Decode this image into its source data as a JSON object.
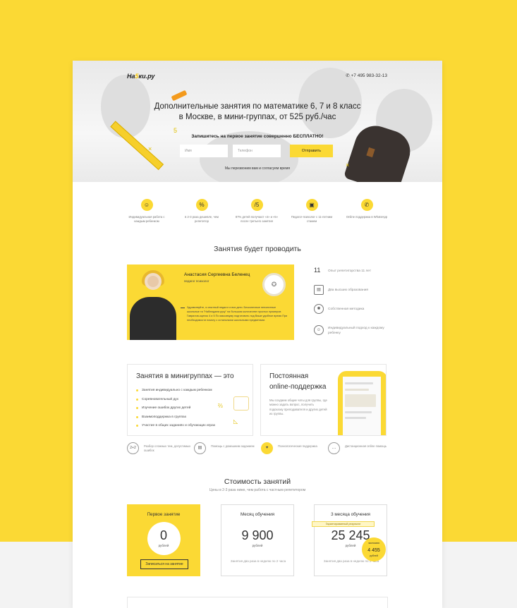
{
  "header": {
    "logo_prefix": "На",
    "logo_mark": "5",
    "logo_suffix": "ки.ру",
    "phone": "+7 495 983-32-13"
  },
  "hero": {
    "title_line1": "Дополнительные занятия по математике 6, 7 и 8 класс",
    "title_line2": "в Москве, в мини-группах, от 525 руб./час",
    "subtitle": "Запишитесь на первое занятие совершенно БЕСПЛАТНО!",
    "name_placeholder": "Имя",
    "phone_placeholder": "Телефон",
    "submit_label": "Отправить",
    "note": "Мы перезвоним вам и согласуем время"
  },
  "features": [
    {
      "icon": "smile-icon",
      "glyph": "☺",
      "text": "Индивидуальная работа с каждым ребенком"
    },
    {
      "icon": "percent-icon",
      "glyph": "%",
      "text": "в 2-3 раза дешевле, чем репетитор"
    },
    {
      "icon": "grade-icon",
      "glyph": "/5",
      "text": "87% детей получают «4» и «5» после третьего занятия"
    },
    {
      "icon": "briefcase-icon",
      "glyph": "▣",
      "text": "Педагог-психолог с 11-летним стажем"
    },
    {
      "icon": "whatsapp-icon",
      "glyph": "✆",
      "text": "Online поддержка в WhatsApp"
    }
  ],
  "teacher_section": {
    "heading": "Занятия будет проводить",
    "name": "Анастасия Сергеевна Беленец",
    "role": "педагог психолог",
    "quote": "Здравствуйте, я опытный педагог и вся дети. Бесконечные непонятные школьные та \"Наблюдаем руку\" на большом количестве простых примеров Гаврилов-оценок 4 и 5 По максимуму подготовить под Ваше удобное время При необходимости помогу с остальными школьными предметами."
  },
  "stats": [
    {
      "icon": "number-11",
      "value": "11",
      "text": "Опыт репетиторства 11 лет"
    },
    {
      "icon": "diploma-icon",
      "value": "",
      "text": "Два высших образования"
    },
    {
      "icon": "brain-icon",
      "value": "",
      "text": "Собственная методика"
    },
    {
      "icon": "smile-icon",
      "value": "",
      "text": "Индивидуальный подход к каждому ребенку"
    }
  ],
  "card_groups": {
    "title": "Занятия в минигруппах — это",
    "items": [
      "Занятия индивидуально с каждым ребенком",
      "Соревновательный дух",
      "Изучение ошибок других детей",
      "Взаимоподдержка в группах",
      "Участие в общих заданиях и обучающих играх"
    ]
  },
  "card_support": {
    "title_line1": "Постоянная",
    "title_line2": "online-поддержка",
    "text": "Мы создаем общие чаты для группы, где можно задать вопрос, получить подсказку преподавателя и других детей из группы."
  },
  "small_features": [
    {
      "icon": "two-plus-two-icon",
      "glyph": "2+2",
      "text": "Разбор сложных тем, допустимых ошибок",
      "highlight": false
    },
    {
      "icon": "documents-icon",
      "glyph": "▤",
      "text": "Помощь с домашним заданием",
      "highlight": false
    },
    {
      "icon": "heart-icon",
      "glyph": "♥",
      "text": "Психологическая поддержка",
      "highlight": true
    },
    {
      "icon": "chat-icon",
      "glyph": "…",
      "text": "Дистанционная online помощь",
      "highlight": false
    }
  ],
  "pricing": {
    "heading": "Стоимость занятий",
    "subheading": "Цены в 2-3 раза ниже, чем работа с частным репетитором",
    "plans": [
      {
        "title": "Первое занятие",
        "price": "0",
        "unit": "рублей",
        "button": "Записаться на занятие"
      },
      {
        "title": "Месяц обучения",
        "price": "9 900",
        "unit": "рублей",
        "note": "Занятия два раза в неделю по 2 часа"
      },
      {
        "title": "3 месяца обучения",
        "price": "25 245",
        "unit": "рублей",
        "note": "Занятия два раза в неделю по 2 часа",
        "ribbon": "Гарантированный результат",
        "discount_label": "экономия",
        "discount_value": "4 455",
        "discount_unit": "рублей"
      }
    ]
  },
  "colors": {
    "accent": "#fbd934",
    "text": "#333333",
    "muted": "#888888"
  }
}
